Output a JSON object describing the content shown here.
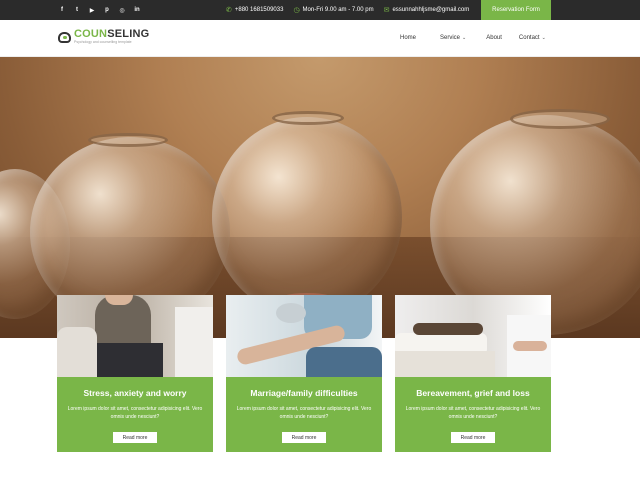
{
  "topbar": {
    "social": [
      {
        "icon": "facebook-icon",
        "glyph": "f"
      },
      {
        "icon": "twitter-icon",
        "glyph": "t"
      },
      {
        "icon": "youtube-icon",
        "glyph": "▶"
      },
      {
        "icon": "pinterest-icon",
        "glyph": "p"
      },
      {
        "icon": "instagram-icon",
        "glyph": "◎"
      },
      {
        "icon": "linkedin-icon",
        "glyph": "in"
      }
    ],
    "phone": "+880 1681509033",
    "hours": "Mon-Fri 9.00 am - 7.00 pm",
    "email": "essunnahhljsme@gmail.com",
    "reservation_label": "Reservation Form"
  },
  "header": {
    "logo_part1": "COUN",
    "logo_part2": "SELING",
    "logo_tagline": "Psychology and counselling template",
    "nav": [
      {
        "label": "Home",
        "dropdown": false
      },
      {
        "label": "Service",
        "dropdown": true
      },
      {
        "label": "About",
        "dropdown": false
      },
      {
        "label": "Contact",
        "dropdown": true
      }
    ]
  },
  "cards": [
    {
      "title": "Stress, anxiety and worry",
      "text": "Lorem ipsum dolor sit amet, consectetur adipisicing elit. Vero omnis unde nesciunt?",
      "button": "Read more"
    },
    {
      "title": "Marriage/family difficulties",
      "text": "Lorem ipsum dolor sit amet, consectetur adipisicing elit. Vero omnis unde nesciunt?",
      "button": "Read more"
    },
    {
      "title": "Bereavement, grief and loss",
      "text": "Lorem ipsum dolor sit amet, consectetur adipisicing elit. Vero omnis unde nesciunt?",
      "button": "Read more"
    }
  ],
  "colors": {
    "accent": "#7ab648",
    "topbar": "#2b2b2b"
  }
}
